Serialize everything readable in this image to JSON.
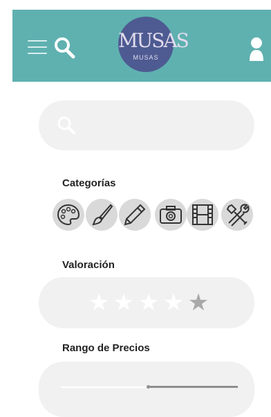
{
  "header": {
    "logo_text": "MUSAS",
    "logo_subtitle": "MUSAS",
    "background_color": "#5fb1b0"
  },
  "search": {
    "placeholder": ""
  },
  "categories": {
    "title": "Categorías",
    "items": [
      {
        "name": "palette-icon"
      },
      {
        "name": "brush-icon"
      },
      {
        "name": "pencil-icon"
      },
      {
        "name": "camera-icon"
      },
      {
        "name": "film-icon"
      },
      {
        "name": "tools-icon"
      }
    ]
  },
  "rating": {
    "title": "Valoración",
    "max": 5,
    "value": 1,
    "stars": [
      "★",
      "★",
      "★",
      "★",
      "★"
    ]
  },
  "price": {
    "title": "Rango de Precios",
    "range_fraction": [
      0.5,
      1.0
    ]
  }
}
